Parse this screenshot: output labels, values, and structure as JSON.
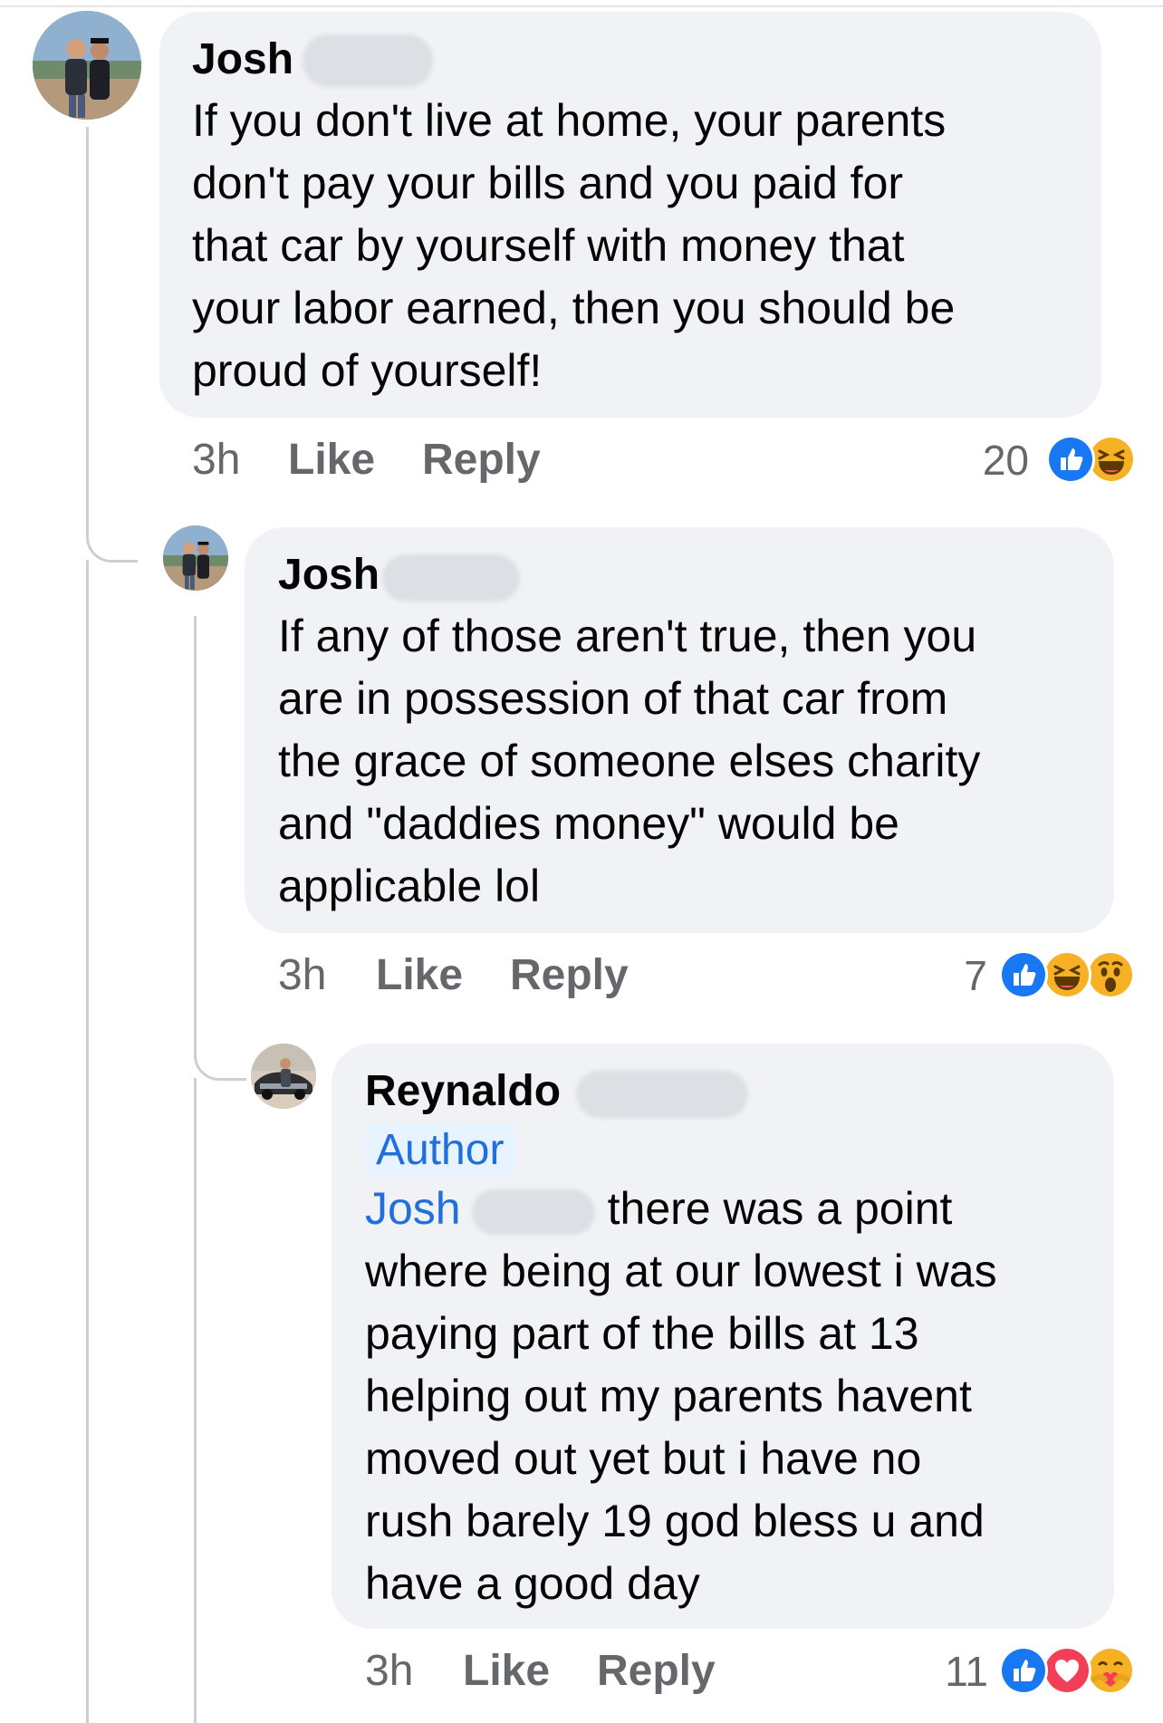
{
  "comments": [
    {
      "author": "Josh",
      "lines": [
        "If you don't live at home, your parents",
        "don't pay your bills and you paid for",
        "that car by yourself with money that",
        "your labor earned,  then you should be",
        "proud of yourself!"
      ],
      "time": "3h",
      "like_label": "Like",
      "reply_label": "Reply",
      "reaction_count": "20",
      "reactions": [
        "like-icon",
        "haha-icon"
      ]
    },
    {
      "author": "Josh",
      "lines": [
        "If any of those aren't true, then you",
        "are in possession of that car from",
        "the grace of someone elses charity",
        "and \"daddies money\" would be",
        "applicable lol"
      ],
      "time": "3h",
      "like_label": "Like",
      "reply_label": "Reply",
      "reaction_count": "7",
      "reactions": [
        "like-icon",
        "haha-icon",
        "wow-icon"
      ]
    },
    {
      "author": "Reynaldo",
      "badge": "Author",
      "mention": "Josh",
      "first_line_rest": "there was a point",
      "lines": [
        "where being at our lowest i was",
        "paying part of the bills  at 13",
        "helping out my parents havent",
        "moved out yet but i have no",
        "rush barely 19 god bless u and",
        "have a good day"
      ],
      "time": "3h",
      "like_label": "Like",
      "reply_label": "Reply",
      "reaction_count": "11",
      "reactions": [
        "like-icon",
        "love-icon",
        "care-icon"
      ]
    }
  ],
  "colors": {
    "bubble": "#f0f2f5",
    "link_blue": "#216fdb",
    "meta_gray": "#65676b",
    "like_blue": "#1877f2",
    "love_red": "#f33e58",
    "emoji_yellow": "#f7b125"
  }
}
